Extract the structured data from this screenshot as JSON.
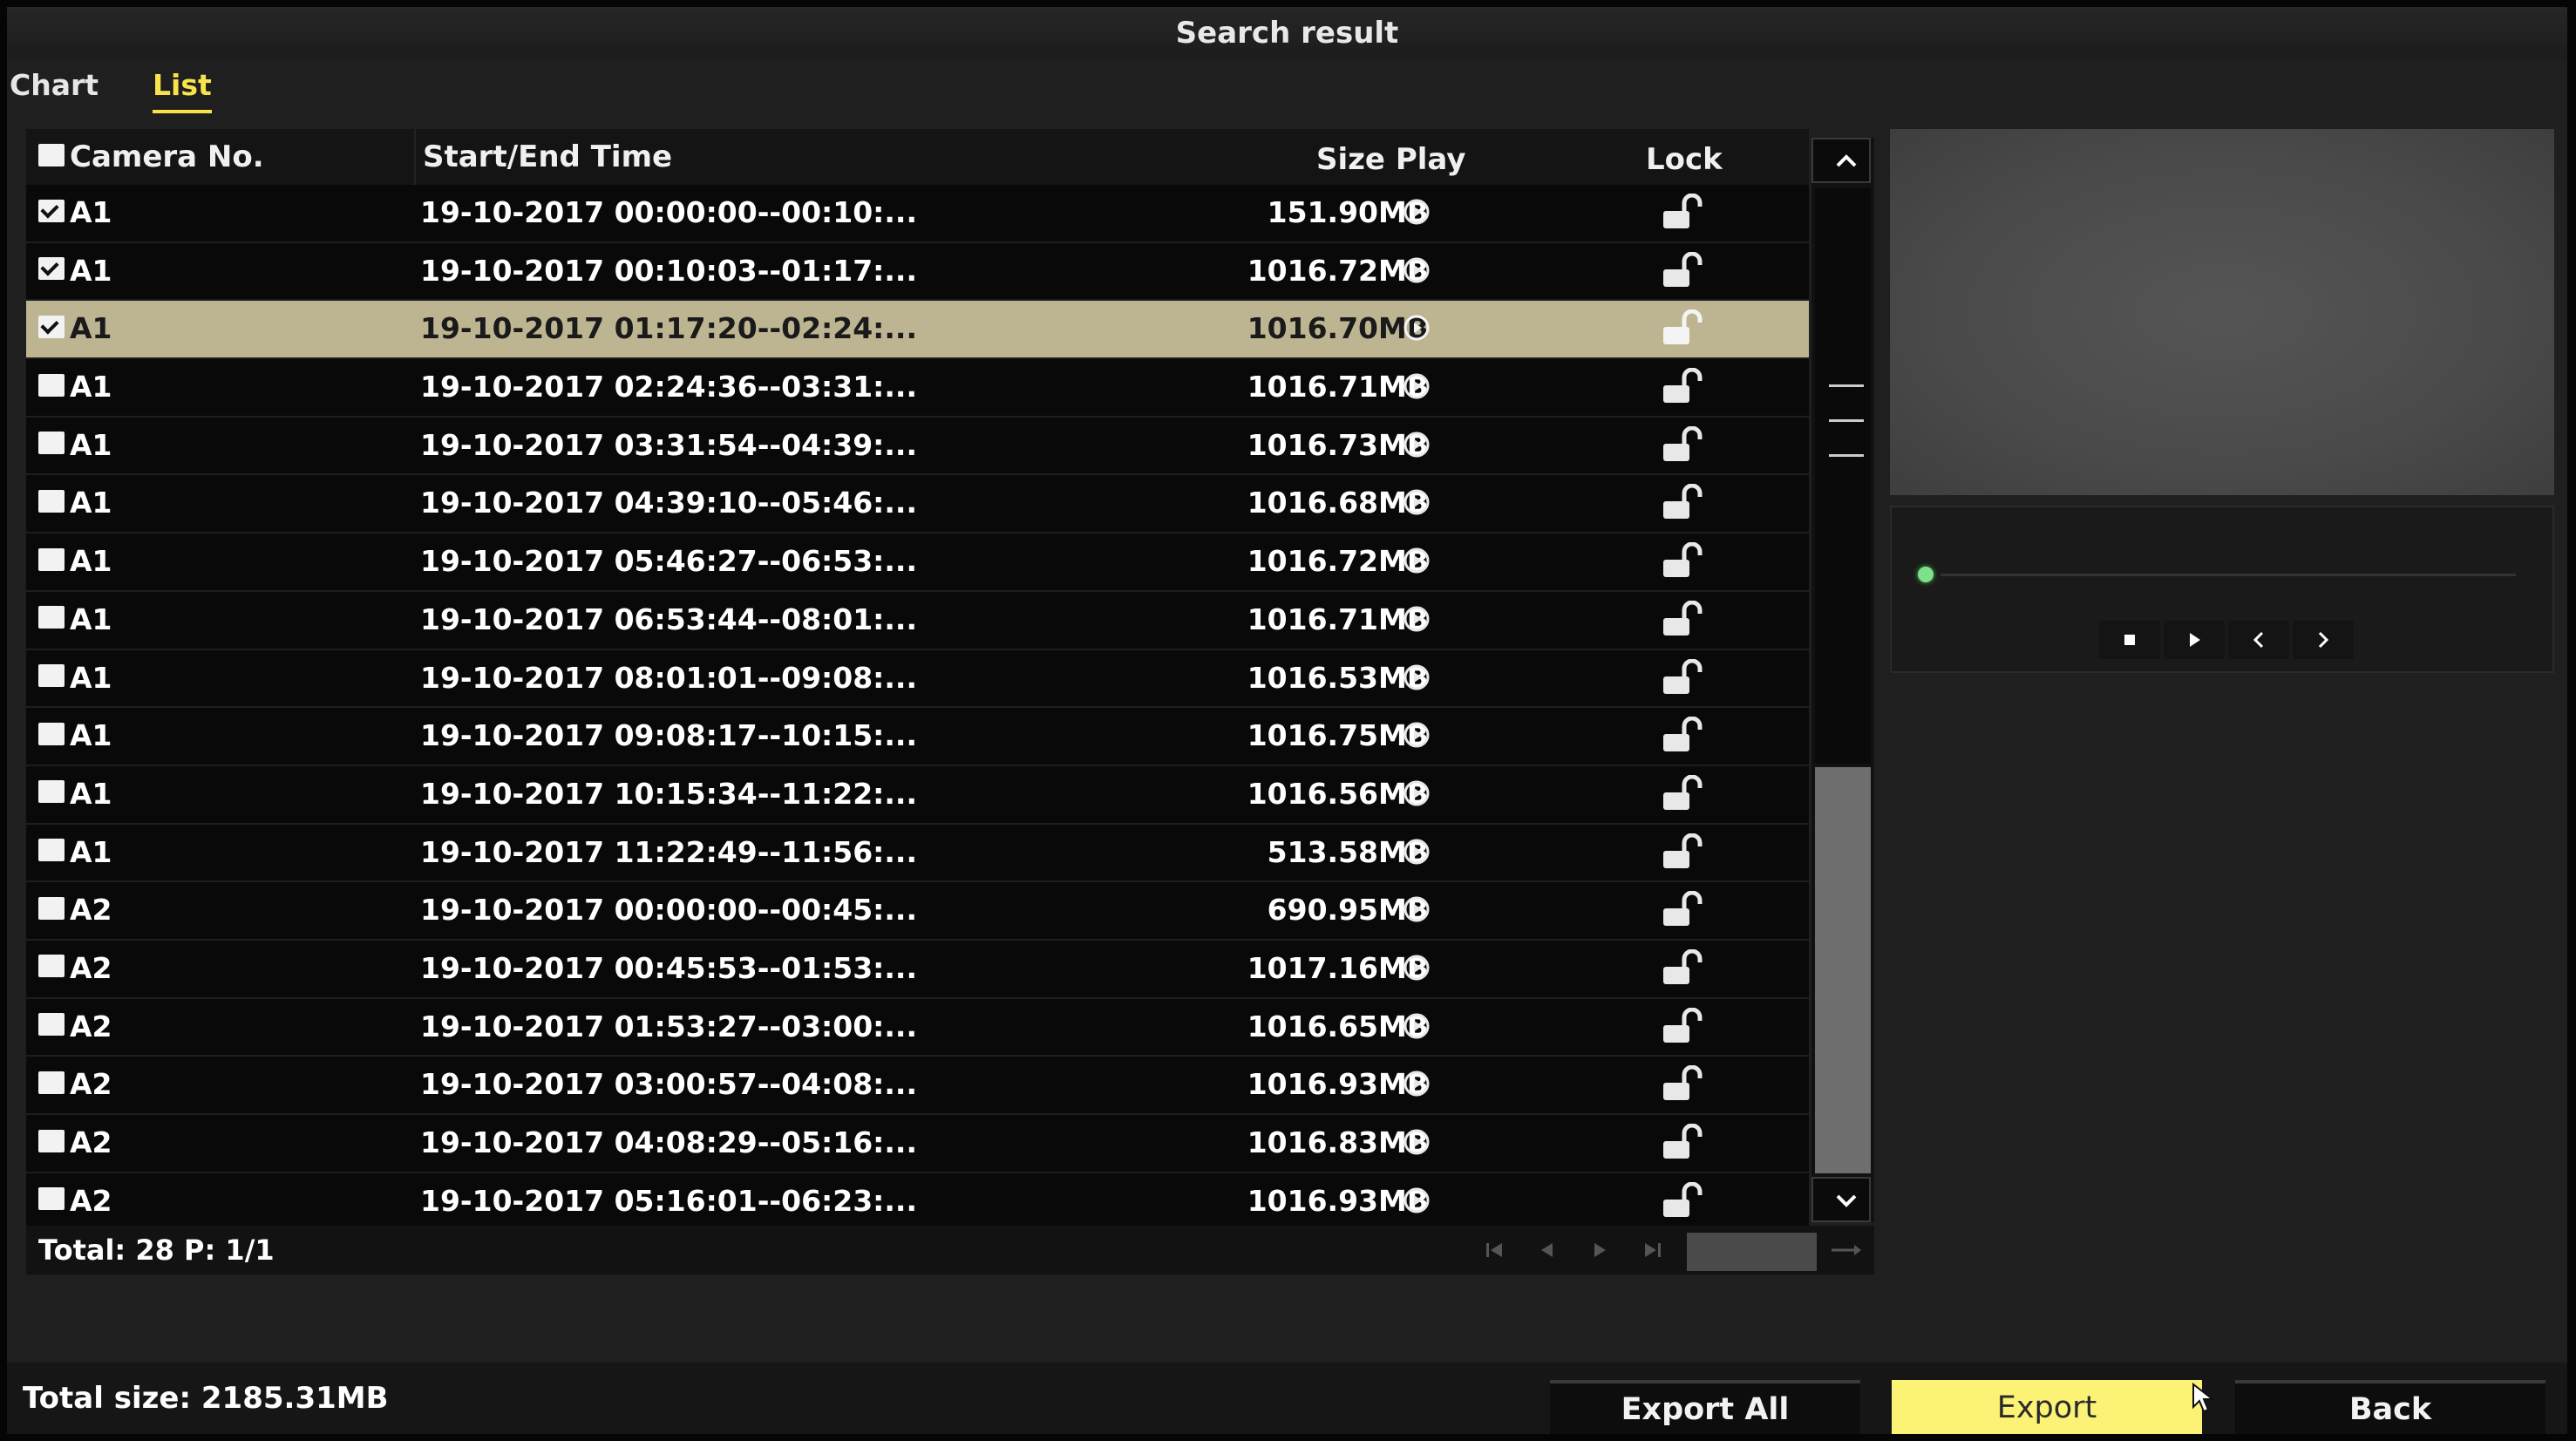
{
  "window": {
    "title": "Search result"
  },
  "tabs": [
    {
      "label": "Chart",
      "active": false
    },
    {
      "label": "List",
      "active": true
    }
  ],
  "list": {
    "headers": {
      "camera": "Camera No.",
      "time": "Start/End Time",
      "size_play": "Size Play",
      "lock": "Lock"
    },
    "rows": [
      {
        "camera": "A1",
        "time": "19-10-2017 00:00:00--00:10:...",
        "size": "151.90MB",
        "checked": true,
        "selected": false
      },
      {
        "camera": "A1",
        "time": "19-10-2017 00:10:03--01:17:...",
        "size": "1016.72MB",
        "checked": true,
        "selected": false
      },
      {
        "camera": "A1",
        "time": "19-10-2017 01:17:20--02:24:...",
        "size": "1016.70MB",
        "checked": true,
        "selected": true
      },
      {
        "camera": "A1",
        "time": "19-10-2017 02:24:36--03:31:...",
        "size": "1016.71MB",
        "checked": false,
        "selected": false
      },
      {
        "camera": "A1",
        "time": "19-10-2017 03:31:54--04:39:...",
        "size": "1016.73MB",
        "checked": false,
        "selected": false
      },
      {
        "camera": "A1",
        "time": "19-10-2017 04:39:10--05:46:...",
        "size": "1016.68MB",
        "checked": false,
        "selected": false
      },
      {
        "camera": "A1",
        "time": "19-10-2017 05:46:27--06:53:...",
        "size": "1016.72MB",
        "checked": false,
        "selected": false
      },
      {
        "camera": "A1",
        "time": "19-10-2017 06:53:44--08:01:...",
        "size": "1016.71MB",
        "checked": false,
        "selected": false
      },
      {
        "camera": "A1",
        "time": "19-10-2017 08:01:01--09:08:...",
        "size": "1016.53MB",
        "checked": false,
        "selected": false
      },
      {
        "camera": "A1",
        "time": "19-10-2017 09:08:17--10:15:...",
        "size": "1016.75MB",
        "checked": false,
        "selected": false
      },
      {
        "camera": "A1",
        "time": "19-10-2017 10:15:34--11:22:...",
        "size": "1016.56MB",
        "checked": false,
        "selected": false
      },
      {
        "camera": "A1",
        "time": "19-10-2017 11:22:49--11:56:...",
        "size": "513.58MB",
        "checked": false,
        "selected": false
      },
      {
        "camera": "A2",
        "time": "19-10-2017 00:00:00--00:45:...",
        "size": "690.95MB",
        "checked": false,
        "selected": false
      },
      {
        "camera": "A2",
        "time": "19-10-2017 00:45:53--01:53:...",
        "size": "1017.16MB",
        "checked": false,
        "selected": false
      },
      {
        "camera": "A2",
        "time": "19-10-2017 01:53:27--03:00:...",
        "size": "1016.65MB",
        "checked": false,
        "selected": false
      },
      {
        "camera": "A2",
        "time": "19-10-2017 03:00:57--04:08:...",
        "size": "1016.93MB",
        "checked": false,
        "selected": false
      },
      {
        "camera": "A2",
        "time": "19-10-2017 04:08:29--05:16:...",
        "size": "1016.83MB",
        "checked": false,
        "selected": false
      },
      {
        "camera": "A2",
        "time": "19-10-2017 05:16:01--06:23:...",
        "size": "1016.93MB",
        "checked": false,
        "selected": false
      }
    ]
  },
  "pager": {
    "total_text": "Total: 28  P: 1/1",
    "page_input": ""
  },
  "footer": {
    "total_size": "Total size: 2185.31MB",
    "export_all": "Export All",
    "export": "Export",
    "back": "Back"
  },
  "icons": {
    "play": "play-circle-icon",
    "lock": "unlocked-padlock-icon",
    "playback": [
      "stop-icon",
      "play-icon",
      "step-back-icon",
      "step-forward-icon"
    ]
  },
  "colors": {
    "accent_yellow": "#f7e34c",
    "selected_row": "#bdb592",
    "export_button": "#fbf276",
    "progress_dot": "#7ee08b"
  }
}
